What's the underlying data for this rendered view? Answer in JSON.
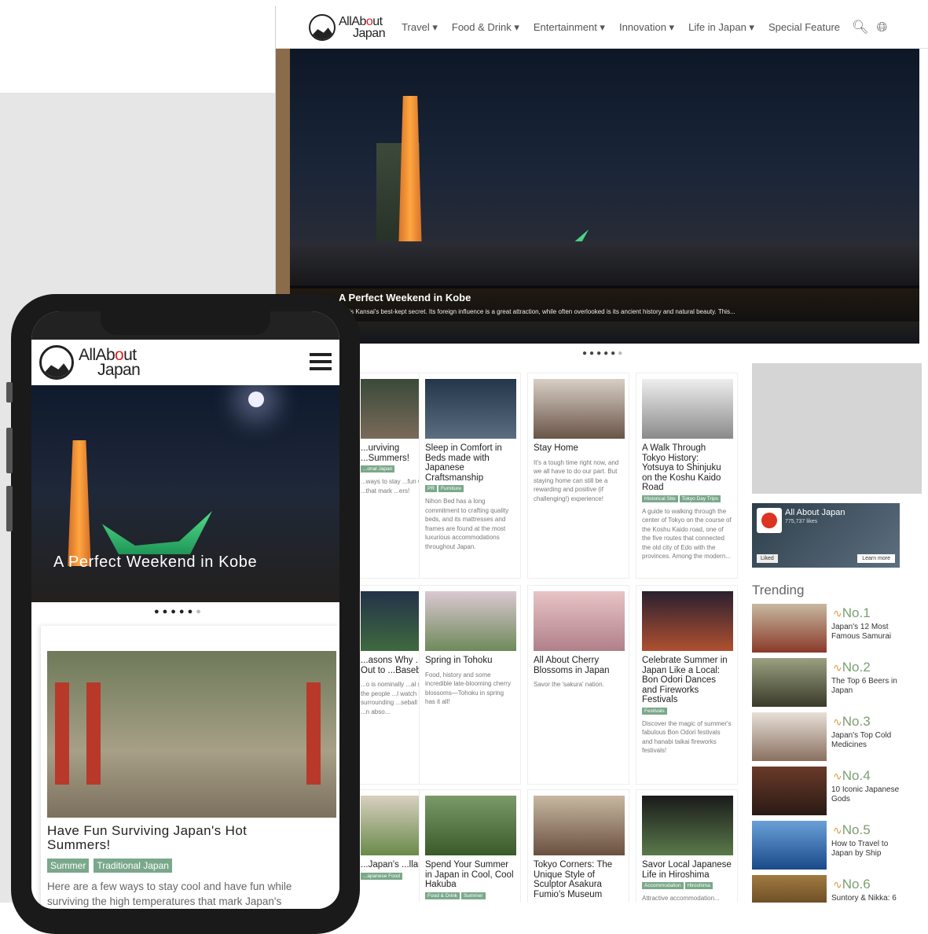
{
  "desktop": {
    "logo": {
      "line1_a": "AllAb",
      "line1_dot": "o",
      "line1_b": "ut",
      "line2": "Japan"
    },
    "nav": [
      {
        "label": "Travel ▾"
      },
      {
        "label": "Food & Drink ▾"
      },
      {
        "label": "Entertainment ▾"
      },
      {
        "label": "Innovation ▾"
      },
      {
        "label": "Life in Japan ▾"
      },
      {
        "label": "Special Feature"
      }
    ],
    "icons": {
      "search": "search-icon",
      "globe": "globe-icon"
    },
    "hero": {
      "title": "A Perfect Weekend in Kobe",
      "description": "...e is Kansai's best-kept secret. Its foreign influence is a great attraction, while often overlooked is its ancient history and natural beauty. This..."
    },
    "carousel": {
      "active": 5,
      "total": 6
    },
    "cards": [
      {
        "title": "...urviving ...Summers!",
        "tags": [
          "...onal Japan"
        ],
        "desc": "...ways to stay ...fun while ...igh ...that mark ...ers!"
      },
      {
        "title": "Sleep in Comfort in Beds made with Japanese Craftsmanship",
        "tags": [
          "PR",
          "Furniture"
        ],
        "desc": "Nihon Bed has a long commitment to crafting quality beds, and its mattresses and frames are found at the most luxurious accommodations throughout Japan."
      },
      {
        "title": "Stay Home",
        "tags": [],
        "desc": "It's a tough time right now, and we all have to do our part. But staying home can still be a rewarding and positive (if challenging!) experience!"
      },
      {
        "title": "A Walk Through Tokyo History: Yotsuya to Shinjuku on the Koshu Kaido Road",
        "tags": [
          "Historical Site",
          "Tokyo Day Trips"
        ],
        "desc": "A guide to walking through the center of Tokyo on the course of the Koshu Kaido road, one of the five routes that connected the old city of Edo with the provinces. Among the modern..."
      },
      {
        "title": "...asons Why ...d Go Out to ...Baseball",
        "tags": [],
        "desc": "...o is nominally ...al sport, ...at the people ...l watch here. ...e surrounding ...seball game is ...n abso..."
      },
      {
        "title": "Spring in Tohoku",
        "tags": [],
        "desc": "Food, history and some incredible late-blooming cherry blossoms—Tohoku in spring has it all!"
      },
      {
        "title": "All About Cherry Blossoms in Japan",
        "tags": [],
        "desc": "Savor the 'sakura' nation."
      },
      {
        "title": "Celebrate Summer in Japan Like a Local: Bon Odori Dances and Fireworks Festivals",
        "tags": [
          "Festivals"
        ],
        "desc": "Discover the magic of summer's fabulous Bon Odori festivals and hanabi taikai fireworks festivals!"
      },
      {
        "title": "...Japan's ...llany of",
        "tags": [
          "...apanese Food"
        ],
        "desc": ""
      },
      {
        "title": "Spend Your Summer in Japan in Cool, Cool Hakuba",
        "tags": [
          "Food & Drink",
          "Summer"
        ],
        "desc": ""
      },
      {
        "title": "Tokyo Corners: The Unique Style of Sculptor Asakura Fumio's Museum",
        "tags": [],
        "desc": ""
      },
      {
        "title": "Savor Local Japanese Life in Hiroshima",
        "tags": [
          "Accommodation",
          "Hiroshima"
        ],
        "desc": "Attractive accommodation..."
      }
    ],
    "facebook": {
      "name": "All About Japan",
      "likes": "775,737 likes",
      "liked": "Liked",
      "learn": "Learn more"
    },
    "trending": {
      "heading": "Trending",
      "items": [
        {
          "rank": "No.1",
          "title": "Japan's 12 Most Famous Samurai"
        },
        {
          "rank": "No.2",
          "title": "The Top 6 Beers in Japan"
        },
        {
          "rank": "No.3",
          "title": "Japan's Top Cold Medicines"
        },
        {
          "rank": "No.4",
          "title": "10 Iconic Japanese Gods"
        },
        {
          "rank": "No.5",
          "title": "How to Travel to Japan by Ship"
        },
        {
          "rank": "No.6",
          "title": "Suntory & Nikka: 6"
        }
      ]
    }
  },
  "mobile": {
    "logo": {
      "line1_a": "AllAb",
      "line1_dot": "o",
      "line1_b": "ut",
      "line2": "Japan"
    },
    "hero_title": "A Perfect Weekend in Kobe",
    "carousel": {
      "active": 5,
      "total": 6
    },
    "card": {
      "title": "Have Fun Surviving Japan's Hot Summers!",
      "tags": [
        "Summer",
        "Traditional Japan"
      ],
      "desc": "Here are a few ways to stay cool and have fun while surviving the high temperatures that mark Japan's"
    }
  },
  "colors": {
    "tag_green": "#7aa88a",
    "logo_red": "#dd2222",
    "rank_green": "#7aa070",
    "pulse_orange": "#e39a3a"
  }
}
